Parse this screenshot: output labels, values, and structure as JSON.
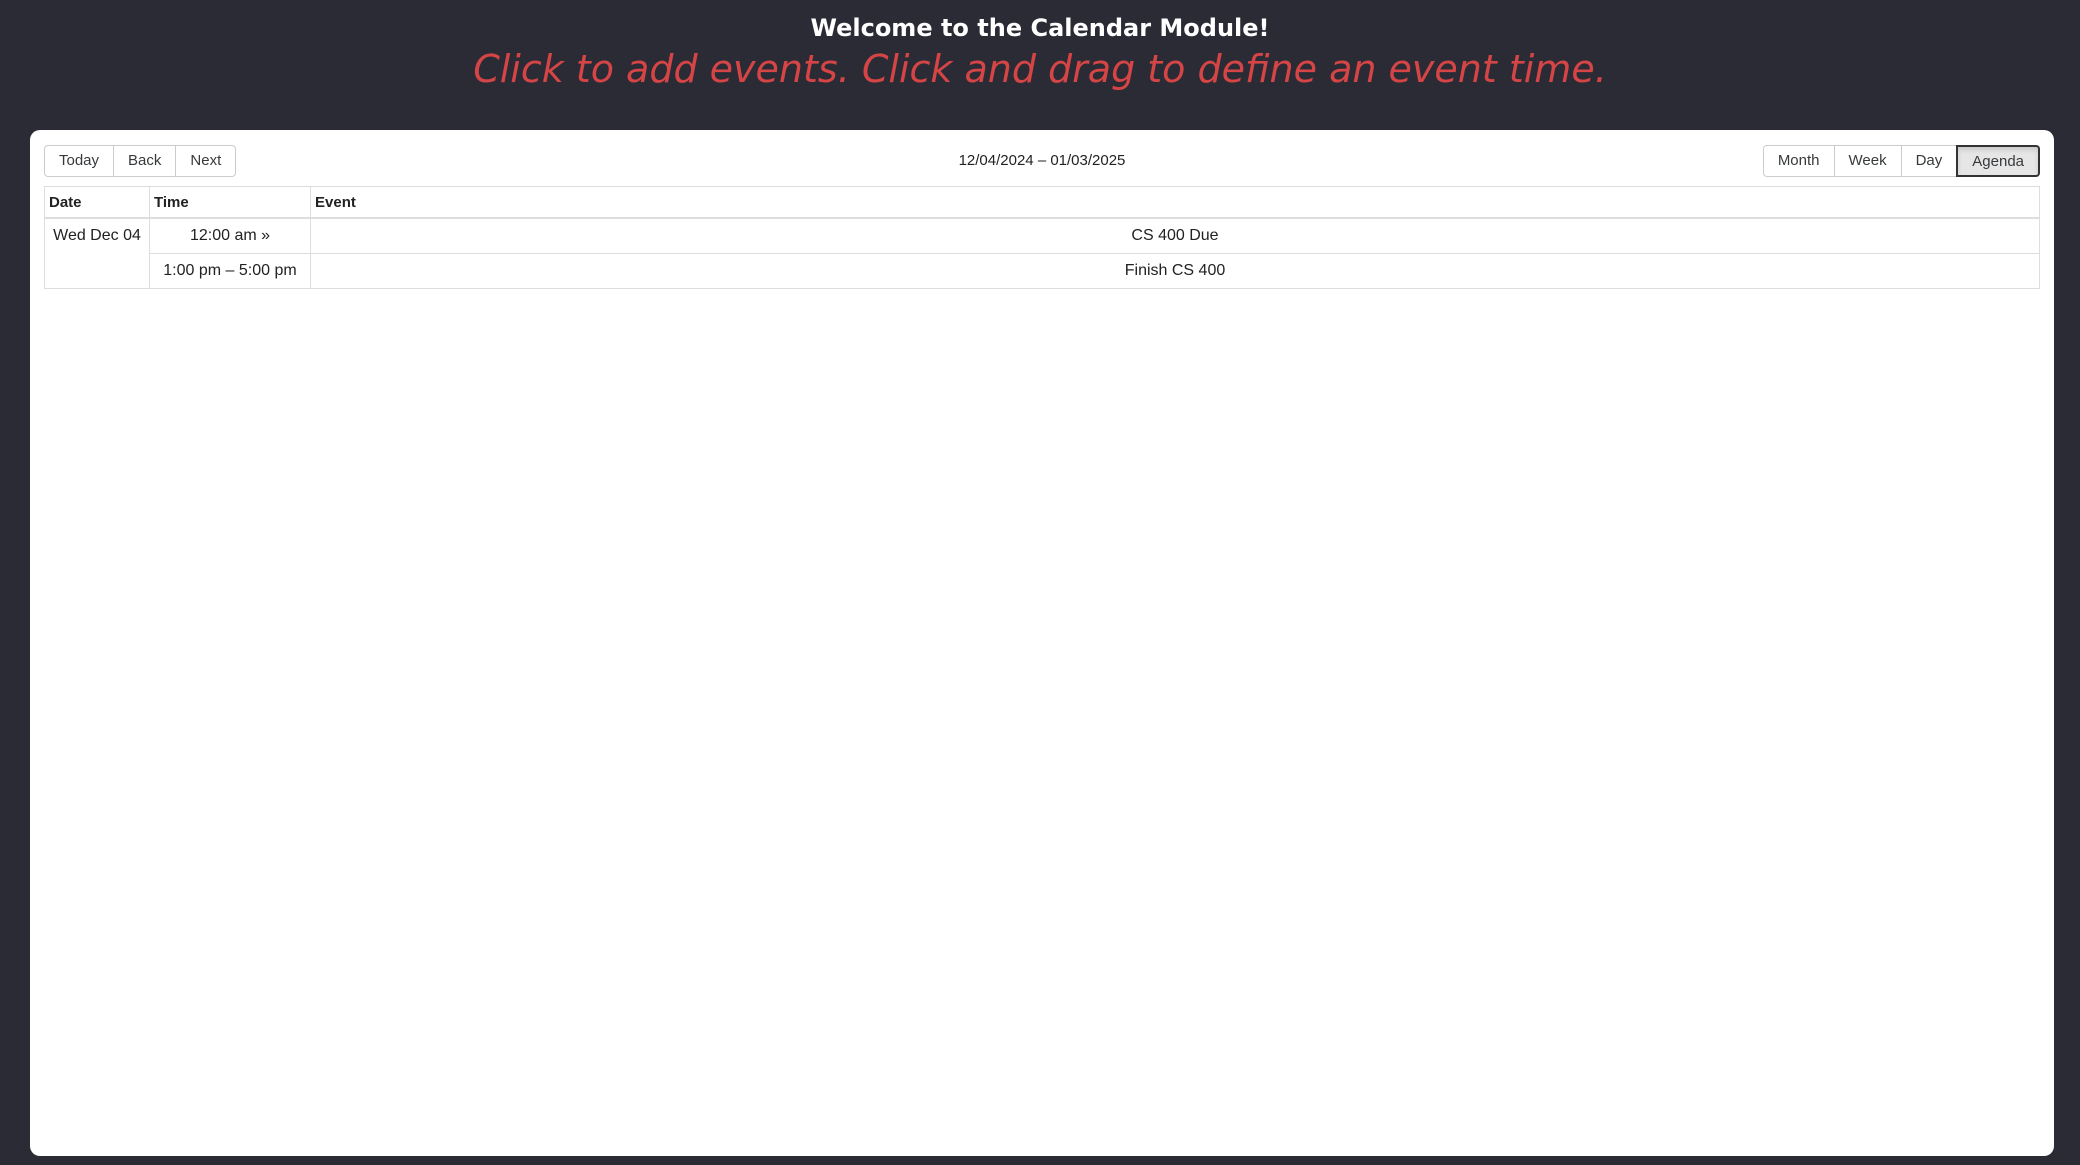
{
  "header": {
    "welcome": "Welcome to the Calendar Module!",
    "instructions": "Click to add events. Click and drag to define an event time."
  },
  "toolbar": {
    "nav": {
      "today": "Today",
      "back": "Back",
      "next": "Next"
    },
    "range": "12/04/2024 – 01/03/2025",
    "views": {
      "month": "Month",
      "week": "Week",
      "day": "Day",
      "agenda": "Agenda"
    },
    "active_view": "Agenda"
  },
  "agenda": {
    "headers": {
      "date": "Date",
      "time": "Time",
      "event": "Event"
    },
    "rows": [
      {
        "date": "Wed Dec 04",
        "time": "12:00 am »",
        "event": "CS 400 Due"
      },
      {
        "date": "",
        "time": "1:00 pm – 5:00 pm",
        "event": "Finish CS 400"
      }
    ]
  },
  "colors": {
    "background": "#2b2b36",
    "instructions": "#d64545",
    "panel": "#ffffff"
  }
}
